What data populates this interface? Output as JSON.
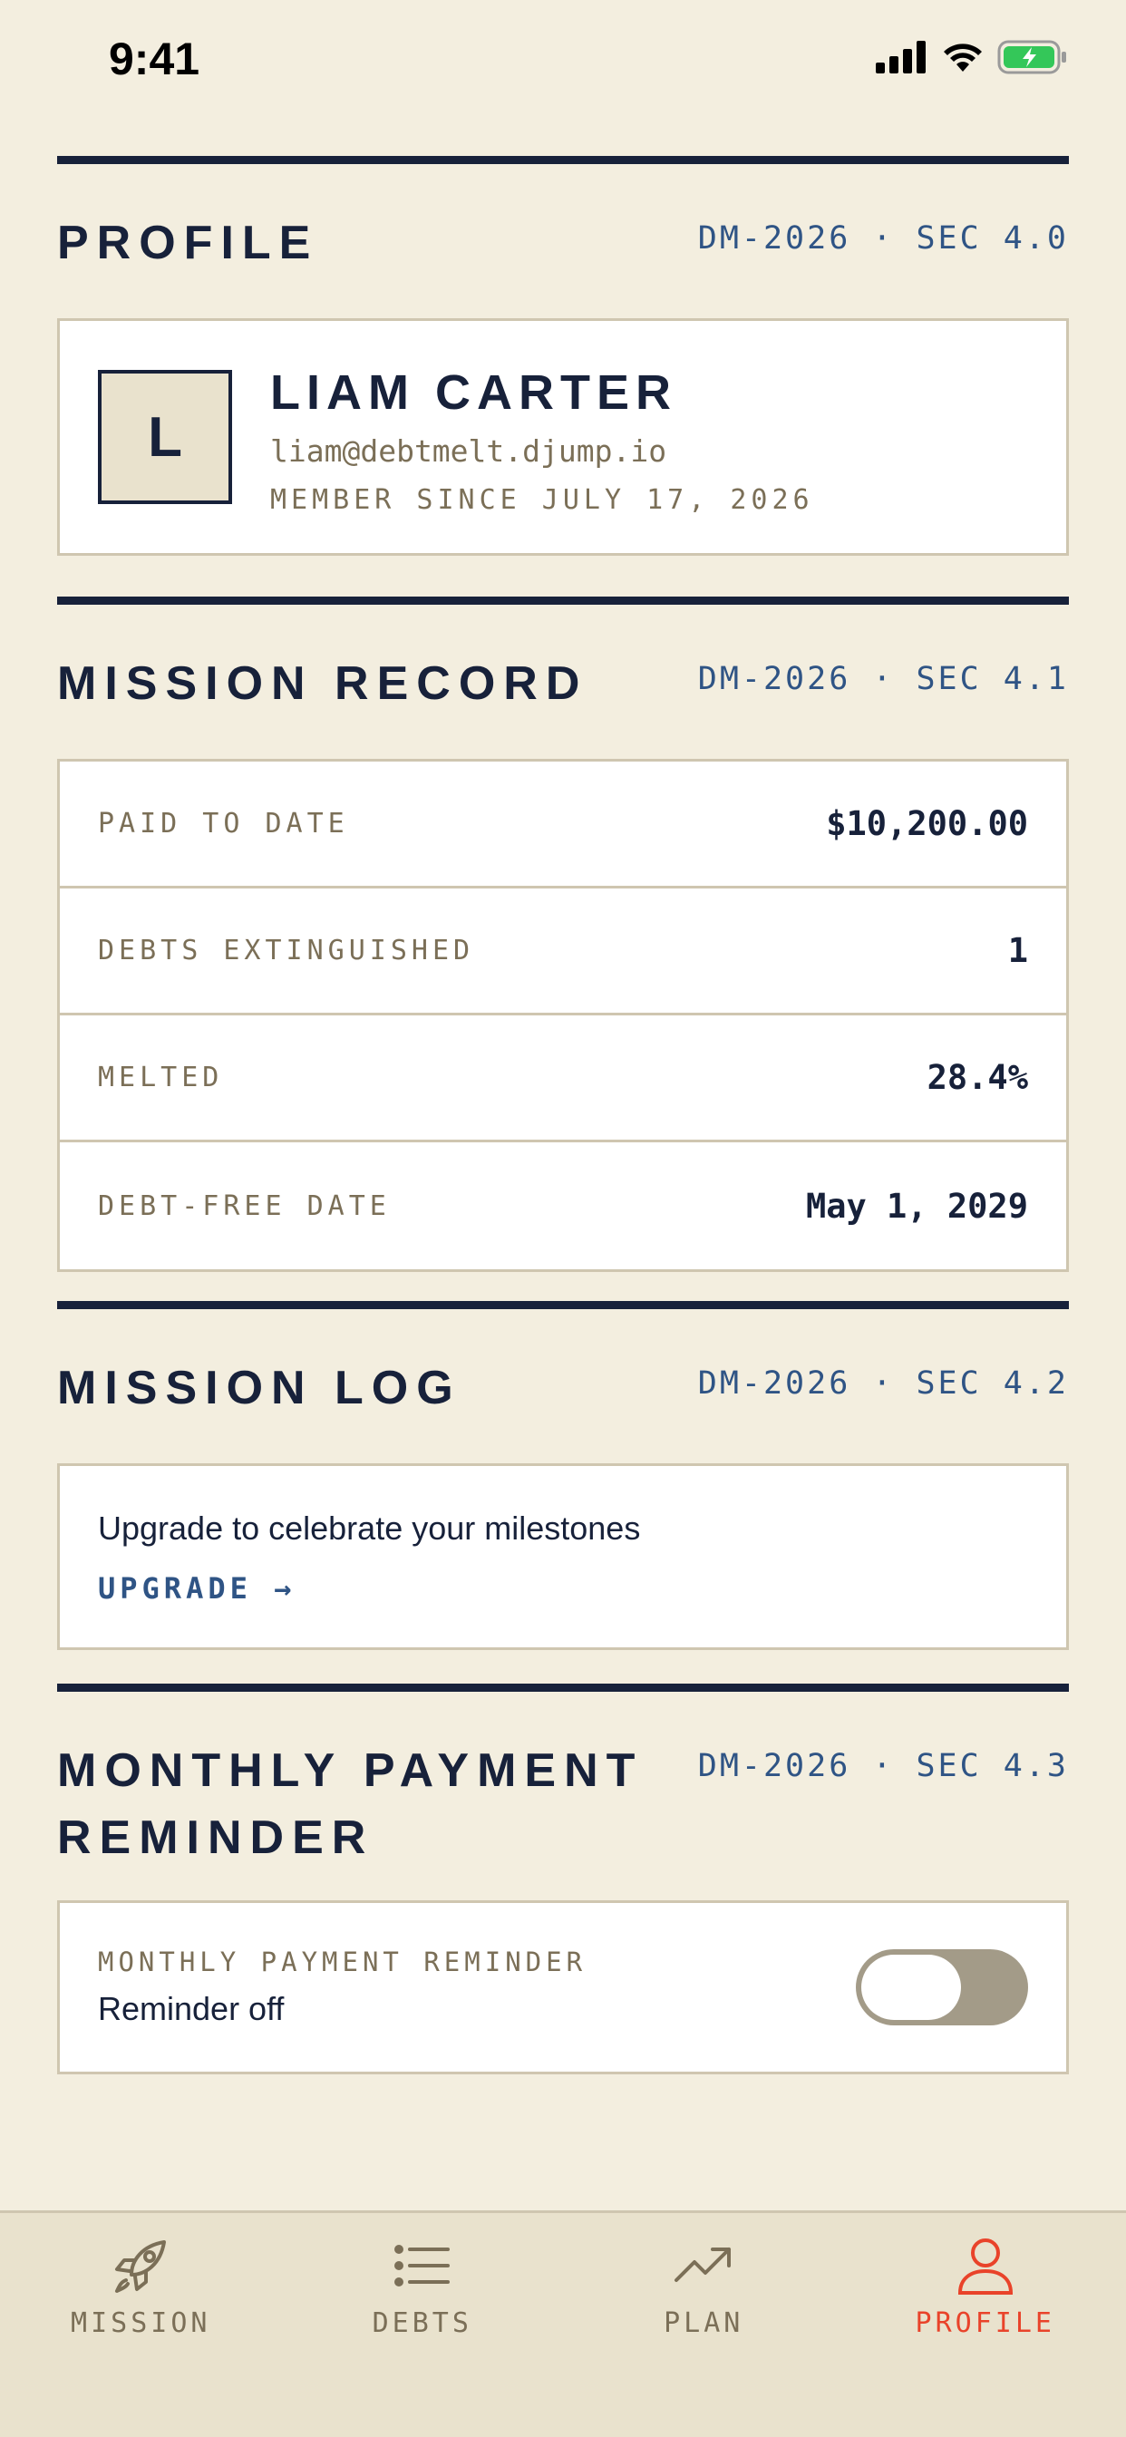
{
  "status_bar": {
    "time": "9:41"
  },
  "sections": {
    "profile": {
      "title": "PROFILE",
      "code": "DM-2026 · SEC 4.0"
    },
    "record": {
      "title": "MISSION RECORD",
      "code": "DM-2026 · SEC 4.1"
    },
    "log": {
      "title": "MISSION LOG",
      "code": "DM-2026 · SEC 4.2"
    },
    "reminder": {
      "title": "MONTHLY PAYMENT REMINDER",
      "code": "DM-2026 · SEC 4.3"
    }
  },
  "profile": {
    "initial": "L",
    "name": "LIAM CARTER",
    "email": "liam@debtmelt.djump.io",
    "member_since": "MEMBER SINCE JULY 17, 2026"
  },
  "stats": [
    {
      "label": "PAID TO DATE",
      "value": "$10,200.00"
    },
    {
      "label": "DEBTS EXTINGUISHED",
      "value": "1"
    },
    {
      "label": "MELTED",
      "value": "28.4%"
    },
    {
      "label": "DEBT-FREE DATE",
      "value": "May 1, 2029"
    }
  ],
  "log": {
    "message": "Upgrade to celebrate your milestones",
    "link": "UPGRADE →"
  },
  "reminder": {
    "label": "MONTHLY PAYMENT REMINDER",
    "state": "Reminder off",
    "enabled": false
  },
  "tabs": [
    {
      "label": "MISSION",
      "icon": "rocket-icon"
    },
    {
      "label": "DEBTS",
      "icon": "list-icon"
    },
    {
      "label": "PLAN",
      "icon": "trend-up-icon"
    },
    {
      "label": "PROFILE",
      "icon": "user-icon",
      "active": true
    }
  ],
  "colors": {
    "background": "#f3eedf",
    "ink": "#17213a",
    "accent_blue": "#2f5485",
    "muted": "#7b6f57",
    "active_tab": "#e9432a",
    "toggle_off": "#a39b88"
  }
}
